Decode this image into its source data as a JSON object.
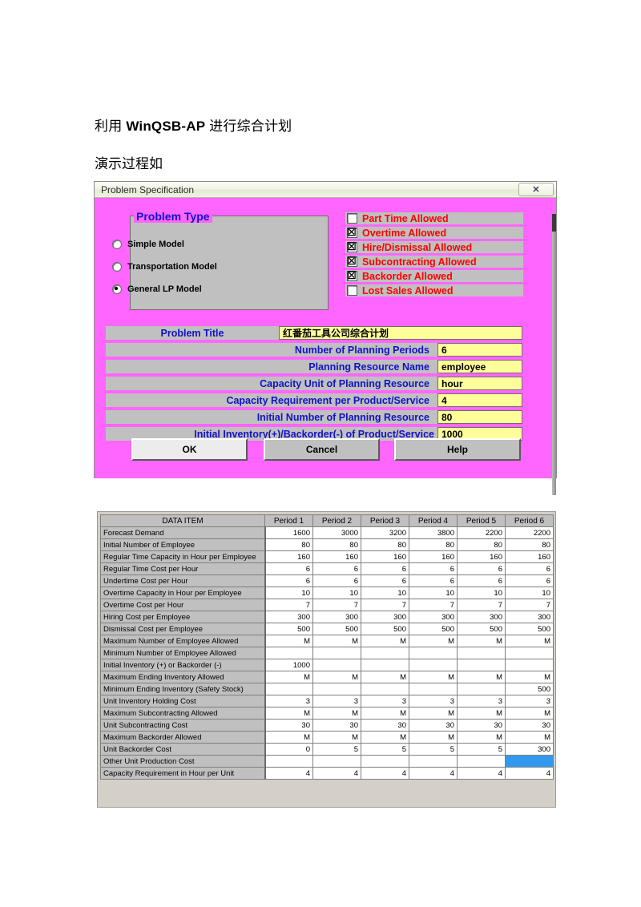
{
  "document": {
    "heading_pre": "利用 ",
    "heading_bold": "WinQSB-AP",
    "heading_post": " 进行综合计划",
    "subheading": "演示过程如"
  },
  "dialog": {
    "title": "Problem Specification",
    "close_label": "✕",
    "problem_type": {
      "legend": "Problem Type",
      "options": [
        {
          "label": "Simple Model",
          "selected": false
        },
        {
          "label": "Transportation Model",
          "selected": false
        },
        {
          "label": "General LP Model",
          "selected": true
        }
      ]
    },
    "options": [
      {
        "label": "Part Time Allowed",
        "checked": false
      },
      {
        "label": "Overtime Allowed",
        "checked": true
      },
      {
        "label": "Hire/Dismissal Allowed",
        "checked": true
      },
      {
        "label": "Subcontracting Allowed",
        "checked": true
      },
      {
        "label": "Backorder Allowed",
        "checked": true
      },
      {
        "label": "Lost Sales Allowed",
        "checked": false
      }
    ],
    "fields": [
      {
        "label": "Problem Title",
        "value": "红番茄工具公司综合计划"
      },
      {
        "label": "Number of Planning Periods",
        "value": "6"
      },
      {
        "label": "Planning Resource Name",
        "value": "employee"
      },
      {
        "label": "Capacity Unit of Planning Resource",
        "value": "hour"
      },
      {
        "label": "Capacity Requirement per Product/Service",
        "value": "4"
      },
      {
        "label": "Initial Number of Planning Resource",
        "value": "80"
      },
      {
        "label": "Initial Inventory(+)/Backorder(-) of Product/Service",
        "value": "1000"
      }
    ],
    "buttons": {
      "ok": "OK",
      "cancel": "Cancel",
      "help": "Help"
    },
    "colors": {
      "dialog_background": "#ff66ff",
      "control_face": "#c0c0c0",
      "input_background": "#ffff99",
      "label_text": "#1212c8",
      "option_text": "#ff0000"
    }
  },
  "table": {
    "columns": [
      "DATA ITEM",
      "Period 1",
      "Period 2",
      "Period 3",
      "Period 4",
      "Period 5",
      "Period 6"
    ],
    "selected_cell": {
      "row": 19,
      "col": 6
    },
    "selection_color": "#3399ee",
    "rows": [
      {
        "item": "Forecast Demand",
        "values": [
          "1600",
          "3000",
          "3200",
          "3800",
          "2200",
          "2200"
        ]
      },
      {
        "item": "Initial Number of Employee",
        "values": [
          "80",
          "80",
          "80",
          "80",
          "80",
          "80"
        ]
      },
      {
        "item": "Regular Time Capacity in Hour per Employee",
        "values": [
          "160",
          "160",
          "160",
          "160",
          "160",
          "160"
        ]
      },
      {
        "item": "Regular Time Cost per Hour",
        "values": [
          "6",
          "6",
          "6",
          "6",
          "6",
          "6"
        ]
      },
      {
        "item": "Undertime Cost per Hour",
        "values": [
          "6",
          "6",
          "6",
          "6",
          "6",
          "6"
        ]
      },
      {
        "item": "Overtime Capacity in Hour per Employee",
        "values": [
          "10",
          "10",
          "10",
          "10",
          "10",
          "10"
        ]
      },
      {
        "item": "Overtime Cost per Hour",
        "values": [
          "7",
          "7",
          "7",
          "7",
          "7",
          "7"
        ]
      },
      {
        "item": "Hiring Cost per Employee",
        "values": [
          "300",
          "300",
          "300",
          "300",
          "300",
          "300"
        ]
      },
      {
        "item": "Dismissal Cost per Employee",
        "values": [
          "500",
          "500",
          "500",
          "500",
          "500",
          "500"
        ]
      },
      {
        "item": "Maximum Number of Employee Allowed",
        "values": [
          "M",
          "M",
          "M",
          "M",
          "M",
          "M"
        ]
      },
      {
        "item": "Minimum Number of Employee Allowed",
        "values": [
          "",
          "",
          "",
          "",
          "",
          ""
        ]
      },
      {
        "item": "Initial Inventory (+) or Backorder (-)",
        "values": [
          "1000",
          "",
          "",
          "",
          "",
          ""
        ]
      },
      {
        "item": "Maximum Ending Inventory Allowed",
        "values": [
          "M",
          "M",
          "M",
          "M",
          "M",
          "M"
        ]
      },
      {
        "item": "Minimum Ending Inventory (Safety Stock)",
        "values": [
          "",
          "",
          "",
          "",
          "",
          "500"
        ]
      },
      {
        "item": "Unit Inventory Holding Cost",
        "values": [
          "3",
          "3",
          "3",
          "3",
          "3",
          "3"
        ]
      },
      {
        "item": "Maximum Subcontracting Allowed",
        "values": [
          "M",
          "M",
          "M",
          "M",
          "M",
          "M"
        ]
      },
      {
        "item": "Unit Subcontracting Cost",
        "values": [
          "30",
          "30",
          "30",
          "30",
          "30",
          "30"
        ]
      },
      {
        "item": "Maximum Backorder Allowed",
        "values": [
          "M",
          "M",
          "M",
          "M",
          "M",
          "M"
        ]
      },
      {
        "item": "Unit Backorder Cost",
        "values": [
          "0",
          "5",
          "5",
          "5",
          "5",
          "300"
        ]
      },
      {
        "item": "Other Unit Production Cost",
        "values": [
          "",
          "",
          "",
          "",
          "",
          ""
        ]
      },
      {
        "item": "Capacity Requirement in Hour per Unit",
        "values": [
          "4",
          "4",
          "4",
          "4",
          "4",
          "4"
        ]
      }
    ]
  }
}
